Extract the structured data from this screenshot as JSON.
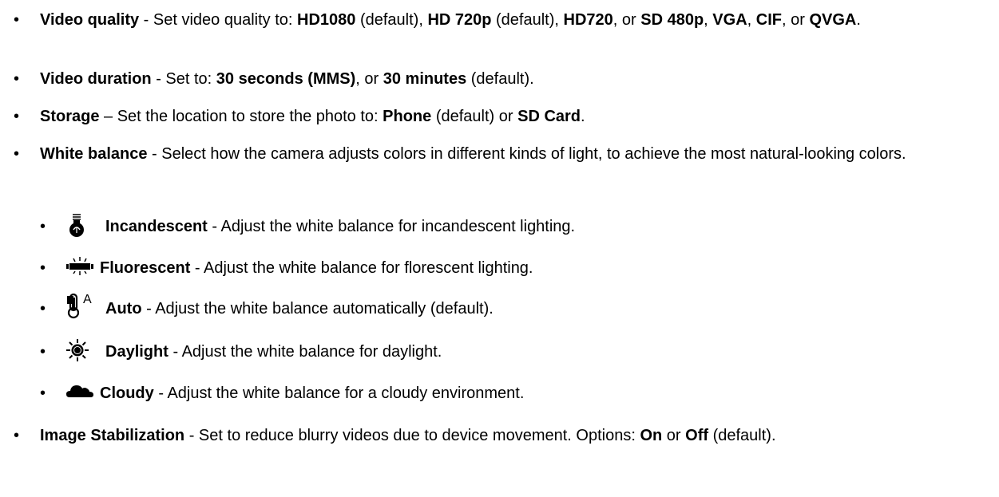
{
  "items": [
    {
      "parts": [
        {
          "t": "Video quality",
          "b": true
        },
        {
          "t": " - Set video quality to: ",
          "b": false
        },
        {
          "t": "HD1080",
          "b": true
        },
        {
          "t": " (default), ",
          "b": false
        },
        {
          "t": "HD 720p",
          "b": true
        },
        {
          "t": " (default), ",
          "b": false
        },
        {
          "t": "HD720",
          "b": true
        },
        {
          "t": ", or ",
          "b": false
        },
        {
          "t": "SD 480p",
          "b": true
        },
        {
          "t": ", ",
          "b": false
        },
        {
          "t": "VGA",
          "b": true
        },
        {
          "t": ", ",
          "b": false
        },
        {
          "t": "CIF",
          "b": true
        },
        {
          "t": ", or ",
          "b": false
        },
        {
          "t": "QVGA",
          "b": true
        },
        {
          "t": ".",
          "b": false
        }
      ]
    },
    {
      "parts": [
        {
          "t": "Video duration",
          "b": true
        },
        {
          "t": " - Set to: ",
          "b": false
        },
        {
          "t": "30 seconds (MMS)",
          "b": true
        },
        {
          "t": ", or ",
          "b": false
        },
        {
          "t": "30 minutes",
          "b": true
        },
        {
          "t": " (default).",
          "b": false
        }
      ]
    },
    {
      "parts": [
        {
          "t": "Storage",
          "b": true
        },
        {
          "t": " – Set the location to store the photo to: ",
          "b": false
        },
        {
          "t": "Phone",
          "b": true
        },
        {
          "t": " (default) or ",
          "b": false
        },
        {
          "t": "SD Card",
          "b": true
        },
        {
          "t": ".",
          "b": false
        }
      ]
    },
    {
      "parts": [
        {
          "t": "White balance",
          "b": true
        },
        {
          "t": " - Select how the camera adjusts colors in different kinds of light, to achieve the most natural-looking colors.",
          "b": false
        }
      ]
    },
    {
      "icon": "incandescent-bulb-icon",
      "parts": [
        {
          "t": "Incandescent",
          "b": true
        },
        {
          "t": " - Adjust the white balance for incandescent lighting.",
          "b": false
        }
      ]
    },
    {
      "icon": "fluorescent-tube-icon",
      "parts": [
        {
          "t": "Fluorescent",
          "b": true
        },
        {
          "t": " - Adjust the white balance for florescent lighting.",
          "b": false
        }
      ]
    },
    {
      "icon": "auto-white-balance-icon",
      "icon_text": "A",
      "parts": [
        {
          "t": "Auto",
          "b": true
        },
        {
          "t": " - Adjust the white balance automatically (default).",
          "b": false
        }
      ]
    },
    {
      "icon": "daylight-sun-icon",
      "parts": [
        {
          "t": "Daylight",
          "b": true
        },
        {
          "t": " - Adjust the white balance for daylight.",
          "b": false
        }
      ]
    },
    {
      "icon": "cloudy-cloud-icon",
      "parts": [
        {
          "t": "Cloudy",
          "b": true
        },
        {
          "t": " - Adjust the white balance for a cloudy environment.",
          "b": false
        }
      ]
    },
    {
      "parts": [
        {
          "t": "Image Stabilization",
          "b": true
        },
        {
          "t": " - Set to reduce blurry videos due to device movement. Options: ",
          "b": false
        },
        {
          "t": "On",
          "b": true
        },
        {
          "t": " or ",
          "b": false
        },
        {
          "t": "Off",
          "b": true
        },
        {
          "t": " (default).",
          "b": false
        }
      ]
    }
  ],
  "bullet_char": "•"
}
